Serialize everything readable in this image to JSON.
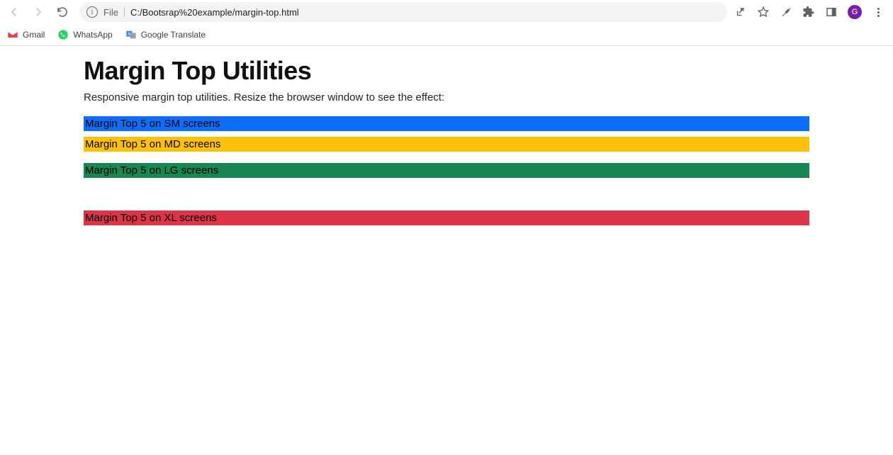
{
  "browser": {
    "url_prefix_label": "File",
    "url": "C:/Bootsrap%20example/margin-top.html",
    "avatar_letter": "G"
  },
  "bookmarks": {
    "gmail": "Gmail",
    "whatsapp": "WhatsApp",
    "google_translate": "Google Translate"
  },
  "page": {
    "heading": "Margin Top Utilities",
    "lead": "Responsive margin top utilities. Resize the browser window to see the effect:",
    "bars": {
      "sm": "Margin Top 5 on SM screens",
      "md": "Margin Top 5 on MD screens",
      "lg": "Margin Top 5 on LG screens",
      "xl": "Margin Top 5 on XL screens"
    }
  },
  "colors": {
    "blue": "#0d6efd",
    "yellow": "#ffc107",
    "green": "#198754",
    "red": "#dc3545"
  }
}
